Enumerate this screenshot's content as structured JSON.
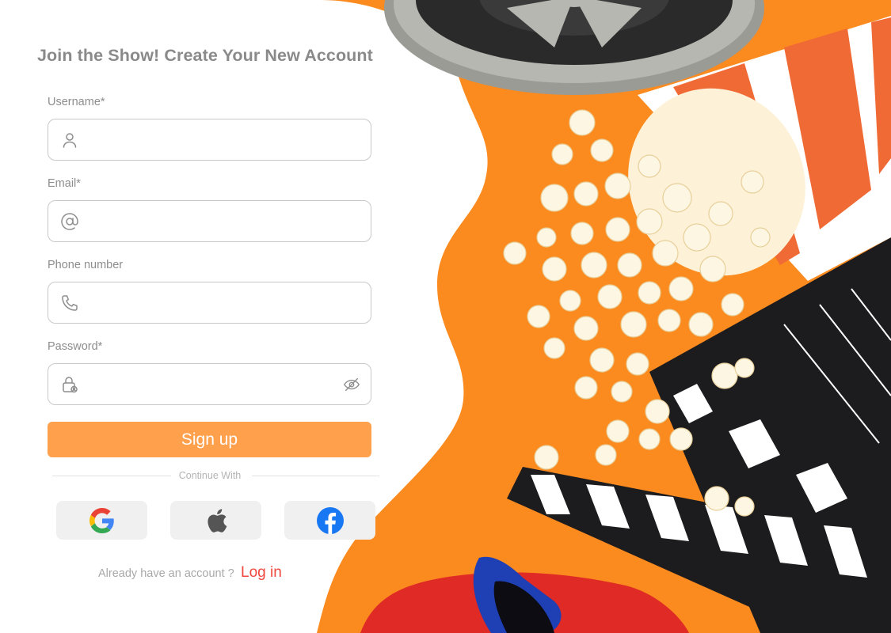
{
  "page": {
    "heading": "Join the Show! Create Your New Account"
  },
  "form": {
    "username": {
      "label": "Username*",
      "value": "",
      "placeholder": "",
      "icon": "user-icon"
    },
    "email": {
      "label": "Email*",
      "value": "",
      "placeholder": "",
      "icon": "at-sign-icon"
    },
    "phone": {
      "label": "Phone number",
      "value": "",
      "placeholder": "",
      "icon": "phone-icon"
    },
    "password": {
      "label": "Password*",
      "value": "",
      "placeholder": "",
      "icon": "lock-icon",
      "toggle_icon": "eye-off-icon"
    },
    "submit_label": "Sign up"
  },
  "social": {
    "divider_text": "Continue With",
    "providers": [
      {
        "name": "google",
        "icon": "google-logo-icon"
      },
      {
        "name": "apple",
        "icon": "apple-logo-icon"
      },
      {
        "name": "facebook",
        "icon": "facebook-logo-icon"
      }
    ]
  },
  "footer": {
    "prompt": "Already have an account ?",
    "login_label": "Log in"
  },
  "colors": {
    "accent": "#ffa04d",
    "link": "#f0473e",
    "background_orange": "#fb8a1f",
    "heading_text": "#8a8a8a"
  }
}
